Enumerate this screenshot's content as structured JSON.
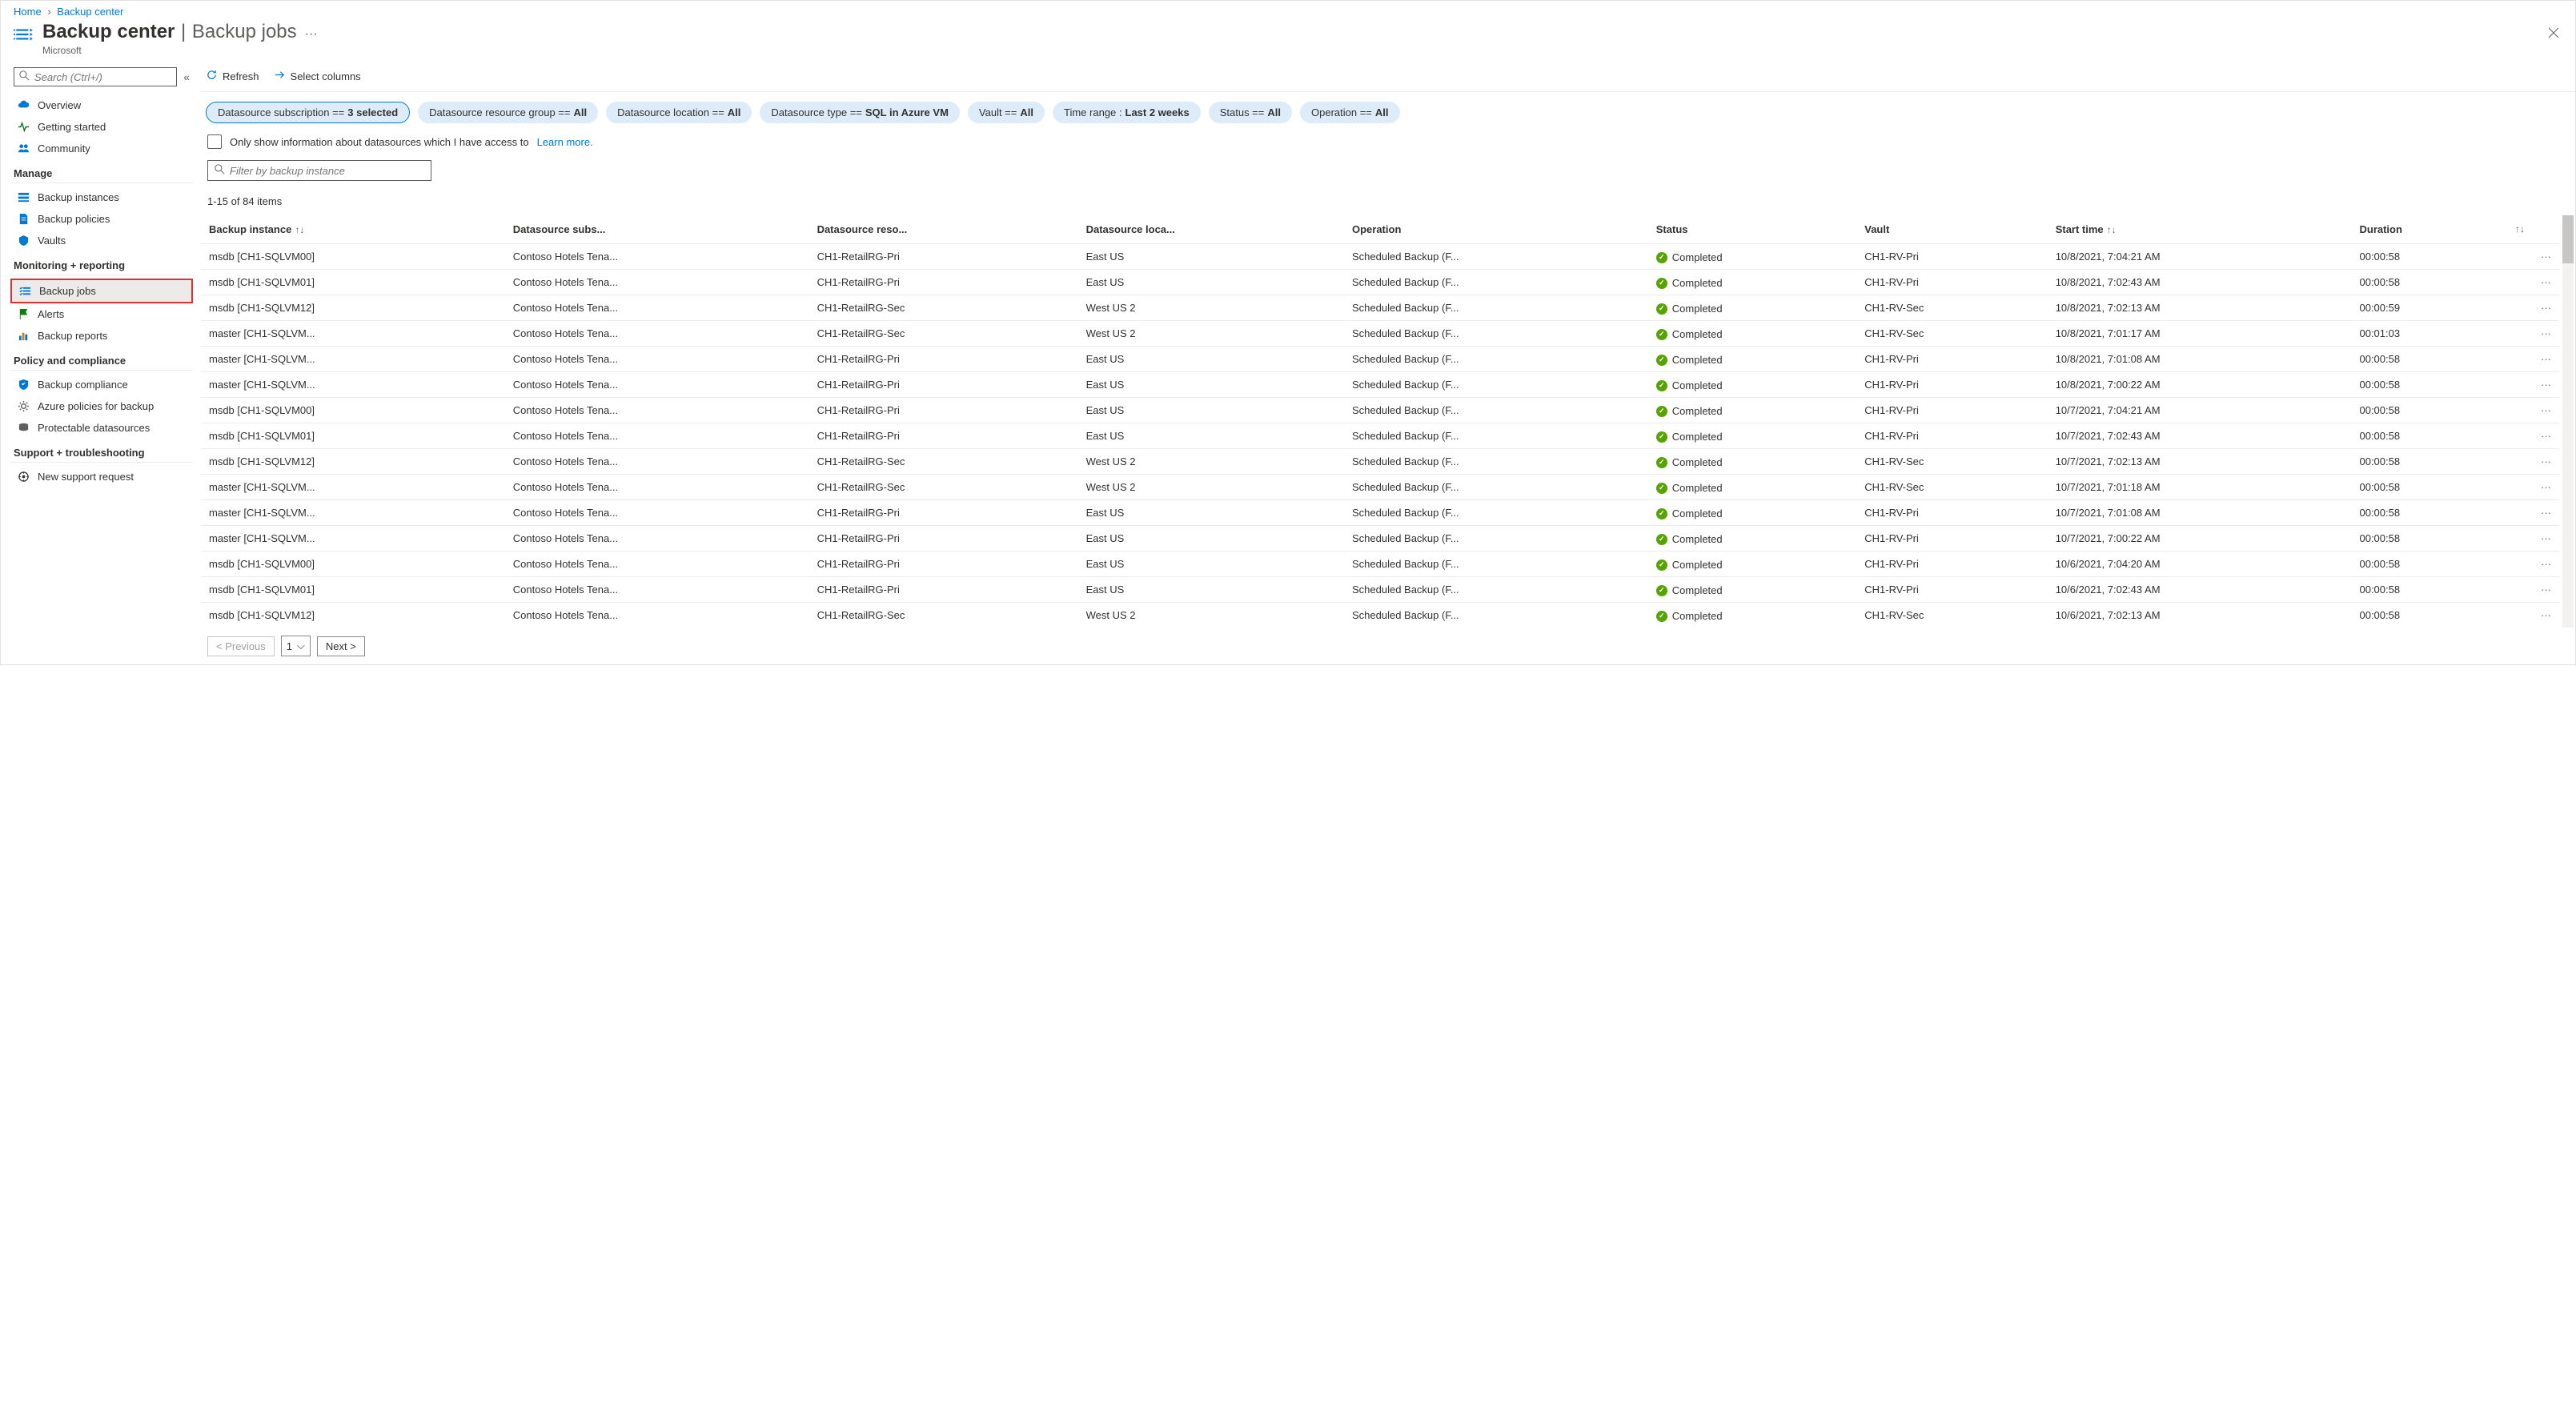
{
  "breadcrumb": {
    "home": "Home",
    "current": "Backup center"
  },
  "header": {
    "title": "Backup center",
    "subtitle": "Backup jobs",
    "org": "Microsoft"
  },
  "sidebar": {
    "search_placeholder": "Search (Ctrl+/)",
    "items_top": [
      {
        "label": "Overview",
        "icon": "cloud",
        "color": "#0078d4"
      },
      {
        "label": "Getting started",
        "icon": "pulse",
        "color": "#107c10"
      },
      {
        "label": "Community",
        "icon": "people",
        "color": "#0078d4"
      }
    ],
    "section_manage": "Manage",
    "items_manage": [
      {
        "label": "Backup instances",
        "icon": "list",
        "color": "#0078d4"
      },
      {
        "label": "Backup policies",
        "icon": "doc",
        "color": "#0078d4"
      },
      {
        "label": "Vaults",
        "icon": "vault",
        "color": "#0078d4"
      }
    ],
    "section_monitoring": "Monitoring + reporting",
    "items_monitoring": [
      {
        "label": "Backup jobs",
        "icon": "checklist",
        "color": "#0078d4",
        "selected": true
      },
      {
        "label": "Alerts",
        "icon": "flag",
        "color": "#107c10"
      },
      {
        "label": "Backup reports",
        "icon": "chart",
        "color": "#0078d4"
      }
    ],
    "section_policy": "Policy and compliance",
    "items_policy": [
      {
        "label": "Backup compliance",
        "icon": "shield",
        "color": "#0078d4"
      },
      {
        "label": "Azure policies for backup",
        "icon": "gear",
        "color": "#605e5c"
      },
      {
        "label": "Protectable datasources",
        "icon": "stack",
        "color": "#605e5c"
      }
    ],
    "section_support": "Support + troubleshooting",
    "items_support": [
      {
        "label": "New support request",
        "icon": "support",
        "color": "#323130"
      }
    ]
  },
  "toolbar": {
    "refresh": "Refresh",
    "select_columns": "Select columns"
  },
  "filters": [
    {
      "label": "Datasource subscription == ",
      "value": "3 selected",
      "active": true
    },
    {
      "label": "Datasource resource group == ",
      "value": "All"
    },
    {
      "label": "Datasource location == ",
      "value": "All"
    },
    {
      "label": "Datasource type == ",
      "value": "SQL in Azure VM"
    },
    {
      "label": "Vault == ",
      "value": "All"
    },
    {
      "label": "Time range : ",
      "value": "Last 2 weeks"
    },
    {
      "label": "Status == ",
      "value": "All"
    },
    {
      "label": "Operation == ",
      "value": "All"
    }
  ],
  "info_checkbox_text": "Only show information about datasources which I have access to",
  "learn_more": "Learn more.",
  "filter_placeholder": "Filter by backup instance",
  "count_label": "1-15 of 84 items",
  "columns": {
    "instance": "Backup instance",
    "subs": "Datasource subs...",
    "rg": "Datasource reso...",
    "loc": "Datasource loca...",
    "op": "Operation",
    "status": "Status",
    "vault": "Vault",
    "start": "Start time",
    "duration": "Duration"
  },
  "rows": [
    {
      "instance": "msdb [CH1-SQLVM00]",
      "subs": "Contoso Hotels Tena...",
      "rg": "CH1-RetailRG-Pri",
      "loc": "East US",
      "op": "Scheduled Backup (F...",
      "status": "Completed",
      "vault": "CH1-RV-Pri",
      "start": "10/8/2021, 7:04:21 AM",
      "duration": "00:00:58"
    },
    {
      "instance": "msdb [CH1-SQLVM01]",
      "subs": "Contoso Hotels Tena...",
      "rg": "CH1-RetailRG-Pri",
      "loc": "East US",
      "op": "Scheduled Backup (F...",
      "status": "Completed",
      "vault": "CH1-RV-Pri",
      "start": "10/8/2021, 7:02:43 AM",
      "duration": "00:00:58"
    },
    {
      "instance": "msdb [CH1-SQLVM12]",
      "subs": "Contoso Hotels Tena...",
      "rg": "CH1-RetailRG-Sec",
      "loc": "West US 2",
      "op": "Scheduled Backup (F...",
      "status": "Completed",
      "vault": "CH1-RV-Sec",
      "start": "10/8/2021, 7:02:13 AM",
      "duration": "00:00:59"
    },
    {
      "instance": "master [CH1-SQLVM...",
      "subs": "Contoso Hotels Tena...",
      "rg": "CH1-RetailRG-Sec",
      "loc": "West US 2",
      "op": "Scheduled Backup (F...",
      "status": "Completed",
      "vault": "CH1-RV-Sec",
      "start": "10/8/2021, 7:01:17 AM",
      "duration": "00:01:03"
    },
    {
      "instance": "master [CH1-SQLVM...",
      "subs": "Contoso Hotels Tena...",
      "rg": "CH1-RetailRG-Pri",
      "loc": "East US",
      "op": "Scheduled Backup (F...",
      "status": "Completed",
      "vault": "CH1-RV-Pri",
      "start": "10/8/2021, 7:01:08 AM",
      "duration": "00:00:58"
    },
    {
      "instance": "master [CH1-SQLVM...",
      "subs": "Contoso Hotels Tena...",
      "rg": "CH1-RetailRG-Pri",
      "loc": "East US",
      "op": "Scheduled Backup (F...",
      "status": "Completed",
      "vault": "CH1-RV-Pri",
      "start": "10/8/2021, 7:00:22 AM",
      "duration": "00:00:58"
    },
    {
      "instance": "msdb [CH1-SQLVM00]",
      "subs": "Contoso Hotels Tena...",
      "rg": "CH1-RetailRG-Pri",
      "loc": "East US",
      "op": "Scheduled Backup (F...",
      "status": "Completed",
      "vault": "CH1-RV-Pri",
      "start": "10/7/2021, 7:04:21 AM",
      "duration": "00:00:58"
    },
    {
      "instance": "msdb [CH1-SQLVM01]",
      "subs": "Contoso Hotels Tena...",
      "rg": "CH1-RetailRG-Pri",
      "loc": "East US",
      "op": "Scheduled Backup (F...",
      "status": "Completed",
      "vault": "CH1-RV-Pri",
      "start": "10/7/2021, 7:02:43 AM",
      "duration": "00:00:58"
    },
    {
      "instance": "msdb [CH1-SQLVM12]",
      "subs": "Contoso Hotels Tena...",
      "rg": "CH1-RetailRG-Sec",
      "loc": "West US 2",
      "op": "Scheduled Backup (F...",
      "status": "Completed",
      "vault": "CH1-RV-Sec",
      "start": "10/7/2021, 7:02:13 AM",
      "duration": "00:00:58"
    },
    {
      "instance": "master [CH1-SQLVM...",
      "subs": "Contoso Hotels Tena...",
      "rg": "CH1-RetailRG-Sec",
      "loc": "West US 2",
      "op": "Scheduled Backup (F...",
      "status": "Completed",
      "vault": "CH1-RV-Sec",
      "start": "10/7/2021, 7:01:18 AM",
      "duration": "00:00:58"
    },
    {
      "instance": "master [CH1-SQLVM...",
      "subs": "Contoso Hotels Tena...",
      "rg": "CH1-RetailRG-Pri",
      "loc": "East US",
      "op": "Scheduled Backup (F...",
      "status": "Completed",
      "vault": "CH1-RV-Pri",
      "start": "10/7/2021, 7:01:08 AM",
      "duration": "00:00:58"
    },
    {
      "instance": "master [CH1-SQLVM...",
      "subs": "Contoso Hotels Tena...",
      "rg": "CH1-RetailRG-Pri",
      "loc": "East US",
      "op": "Scheduled Backup (F...",
      "status": "Completed",
      "vault": "CH1-RV-Pri",
      "start": "10/7/2021, 7:00:22 AM",
      "duration": "00:00:58"
    },
    {
      "instance": "msdb [CH1-SQLVM00]",
      "subs": "Contoso Hotels Tena...",
      "rg": "CH1-RetailRG-Pri",
      "loc": "East US",
      "op": "Scheduled Backup (F...",
      "status": "Completed",
      "vault": "CH1-RV-Pri",
      "start": "10/6/2021, 7:04:20 AM",
      "duration": "00:00:58"
    },
    {
      "instance": "msdb [CH1-SQLVM01]",
      "subs": "Contoso Hotels Tena...",
      "rg": "CH1-RetailRG-Pri",
      "loc": "East US",
      "op": "Scheduled Backup (F...",
      "status": "Completed",
      "vault": "CH1-RV-Pri",
      "start": "10/6/2021, 7:02:43 AM",
      "duration": "00:00:58"
    },
    {
      "instance": "msdb [CH1-SQLVM12]",
      "subs": "Contoso Hotels Tena...",
      "rg": "CH1-RetailRG-Sec",
      "loc": "West US 2",
      "op": "Scheduled Backup (F...",
      "status": "Completed",
      "vault": "CH1-RV-Sec",
      "start": "10/6/2021, 7:02:13 AM",
      "duration": "00:00:58"
    }
  ],
  "pager": {
    "prev": "< Previous",
    "page": "1",
    "next": "Next >"
  }
}
